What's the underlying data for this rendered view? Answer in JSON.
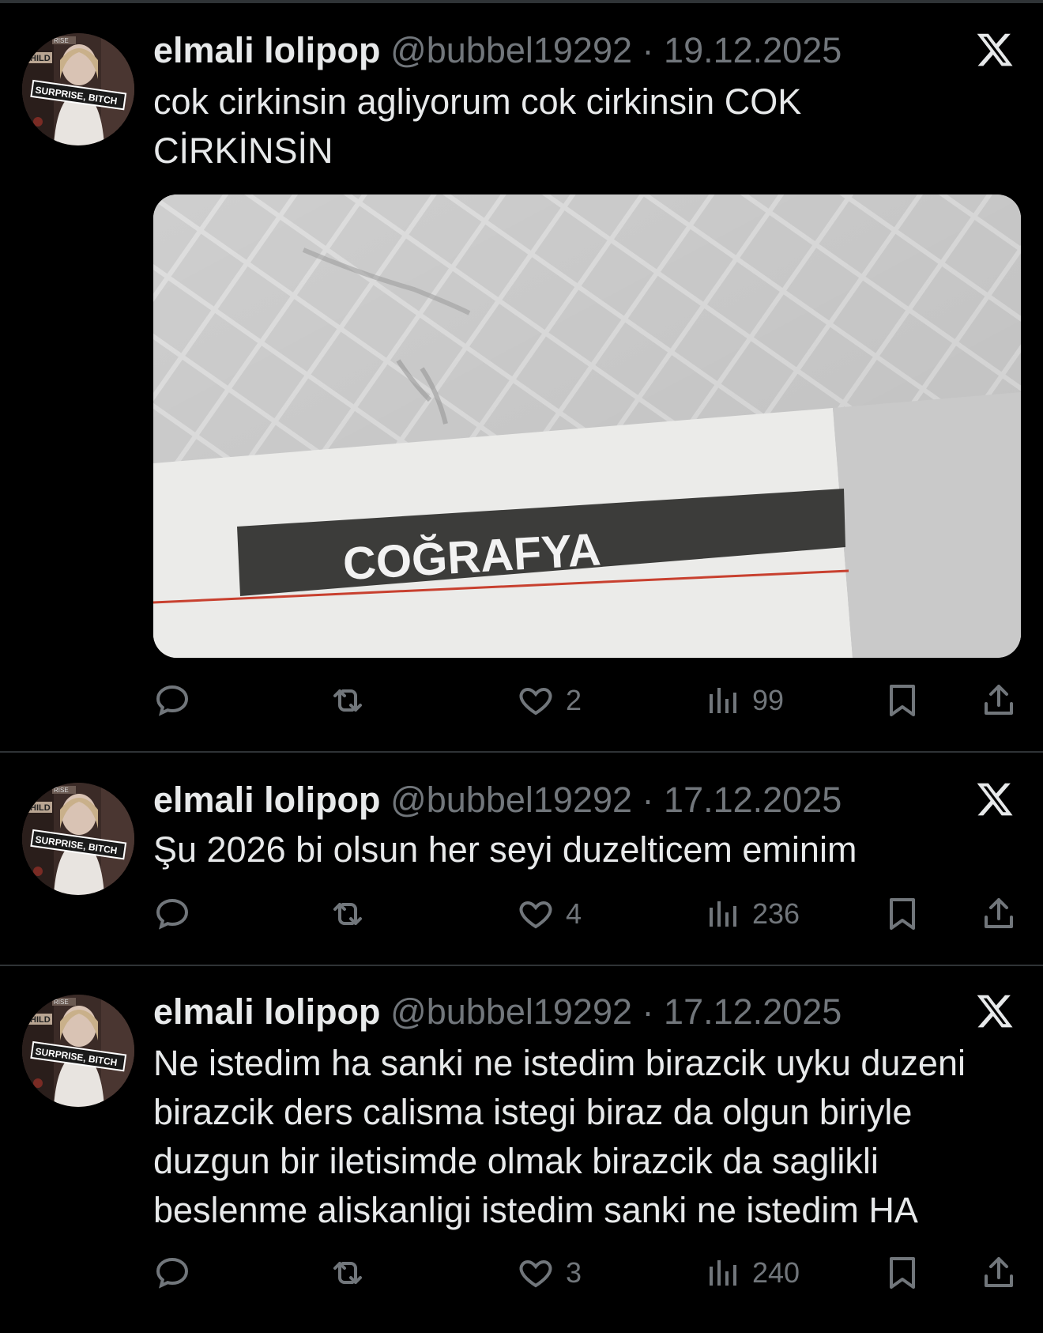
{
  "tweets": [
    {
      "author_name": "elmali lolipop",
      "handle": "@bubbel19292",
      "separator": "·",
      "date": "19.12.2025",
      "text": "cok cirkinsin agliyorum cok cirkinsin COK\nCİRKİNSİN",
      "media_label": "COĞRAFYA",
      "likes": "2",
      "views": "99"
    },
    {
      "author_name": "elmali lolipop",
      "handle": "@bubbel19292",
      "separator": "·",
      "date": "17.12.2025",
      "text": "Şu 2026 bi olsun her seyi duzelticem eminim",
      "likes": "4",
      "views": "236"
    },
    {
      "author_name": "elmali lolipop",
      "handle": "@bubbel19292",
      "separator": "·",
      "date": "17.12.2025",
      "text": "Ne istedim ha sanki ne istedim birazcik uyku duzeni\nbirazcik ders calisma istegi biraz da olgun biriyle\nduzgun bir iletisimde olmak birazcik da saglikli\nbeslenme aliskanligi istedim sanki ne istedim HA",
      "likes": "3",
      "views": "240"
    }
  ],
  "avatar": {
    "sign_text": "SURPRISE, BITCH",
    "sign_small": "HILD",
    "sign_top": "RISE"
  },
  "icons": [
    "reply-icon",
    "retweet-icon",
    "heart-icon",
    "views-icon",
    "bookmark-icon",
    "share-icon",
    "x-logo-icon"
  ],
  "colors": {
    "background": "#000000",
    "text": "#e7e9ea",
    "muted": "#71767b",
    "divider": "#2f3336"
  }
}
